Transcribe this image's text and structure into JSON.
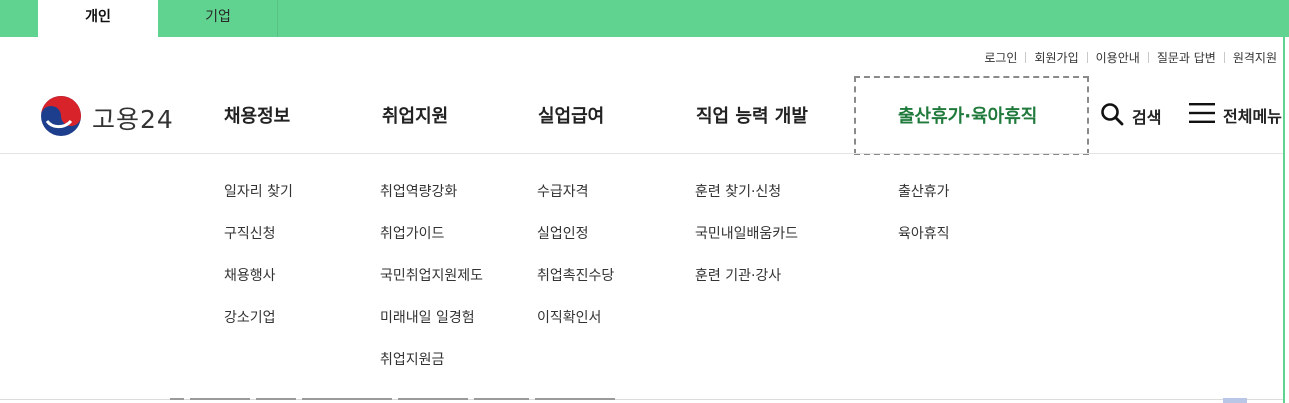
{
  "top_tabs": [
    {
      "label": "개인",
      "active": true
    },
    {
      "label": "기업",
      "active": false
    }
  ],
  "utility_links": [
    "로그인",
    "회원가입",
    "이용안내",
    "질문과 답변",
    "원격지원"
  ],
  "logo": {
    "text": "고용24",
    "icon": "taegeuk-emblem-icon"
  },
  "gnb": [
    {
      "label": "채용정보",
      "active": false,
      "submenu": [
        "일자리 찾기",
        "구직신청",
        "채용행사",
        "강소기업"
      ]
    },
    {
      "label": "취업지원",
      "active": false,
      "submenu": [
        "취업역량강화",
        "취업가이드",
        "국민취업지원제도",
        "미래내일 일경험",
        "취업지원금"
      ]
    },
    {
      "label": "실업급여",
      "active": false,
      "submenu": [
        "수급자격",
        "실업인정",
        "취업촉진수당",
        "이직확인서"
      ]
    },
    {
      "label": "직업 능력 개발",
      "active": false,
      "submenu": [
        "훈련 찾기·신청",
        "국민내일배움카드",
        "훈련 기관·강사"
      ]
    },
    {
      "label": "출산휴가·육아휴직",
      "active": true,
      "submenu": [
        "출산휴가",
        "육아휴직"
      ]
    }
  ],
  "search": {
    "label": "검색",
    "icon": "search-icon"
  },
  "all_menu": {
    "label": "전체메뉴",
    "icon": "hamburger-icon"
  },
  "colors": {
    "topbar": "#5fd38f",
    "active_menu": "#1f7a3c"
  }
}
